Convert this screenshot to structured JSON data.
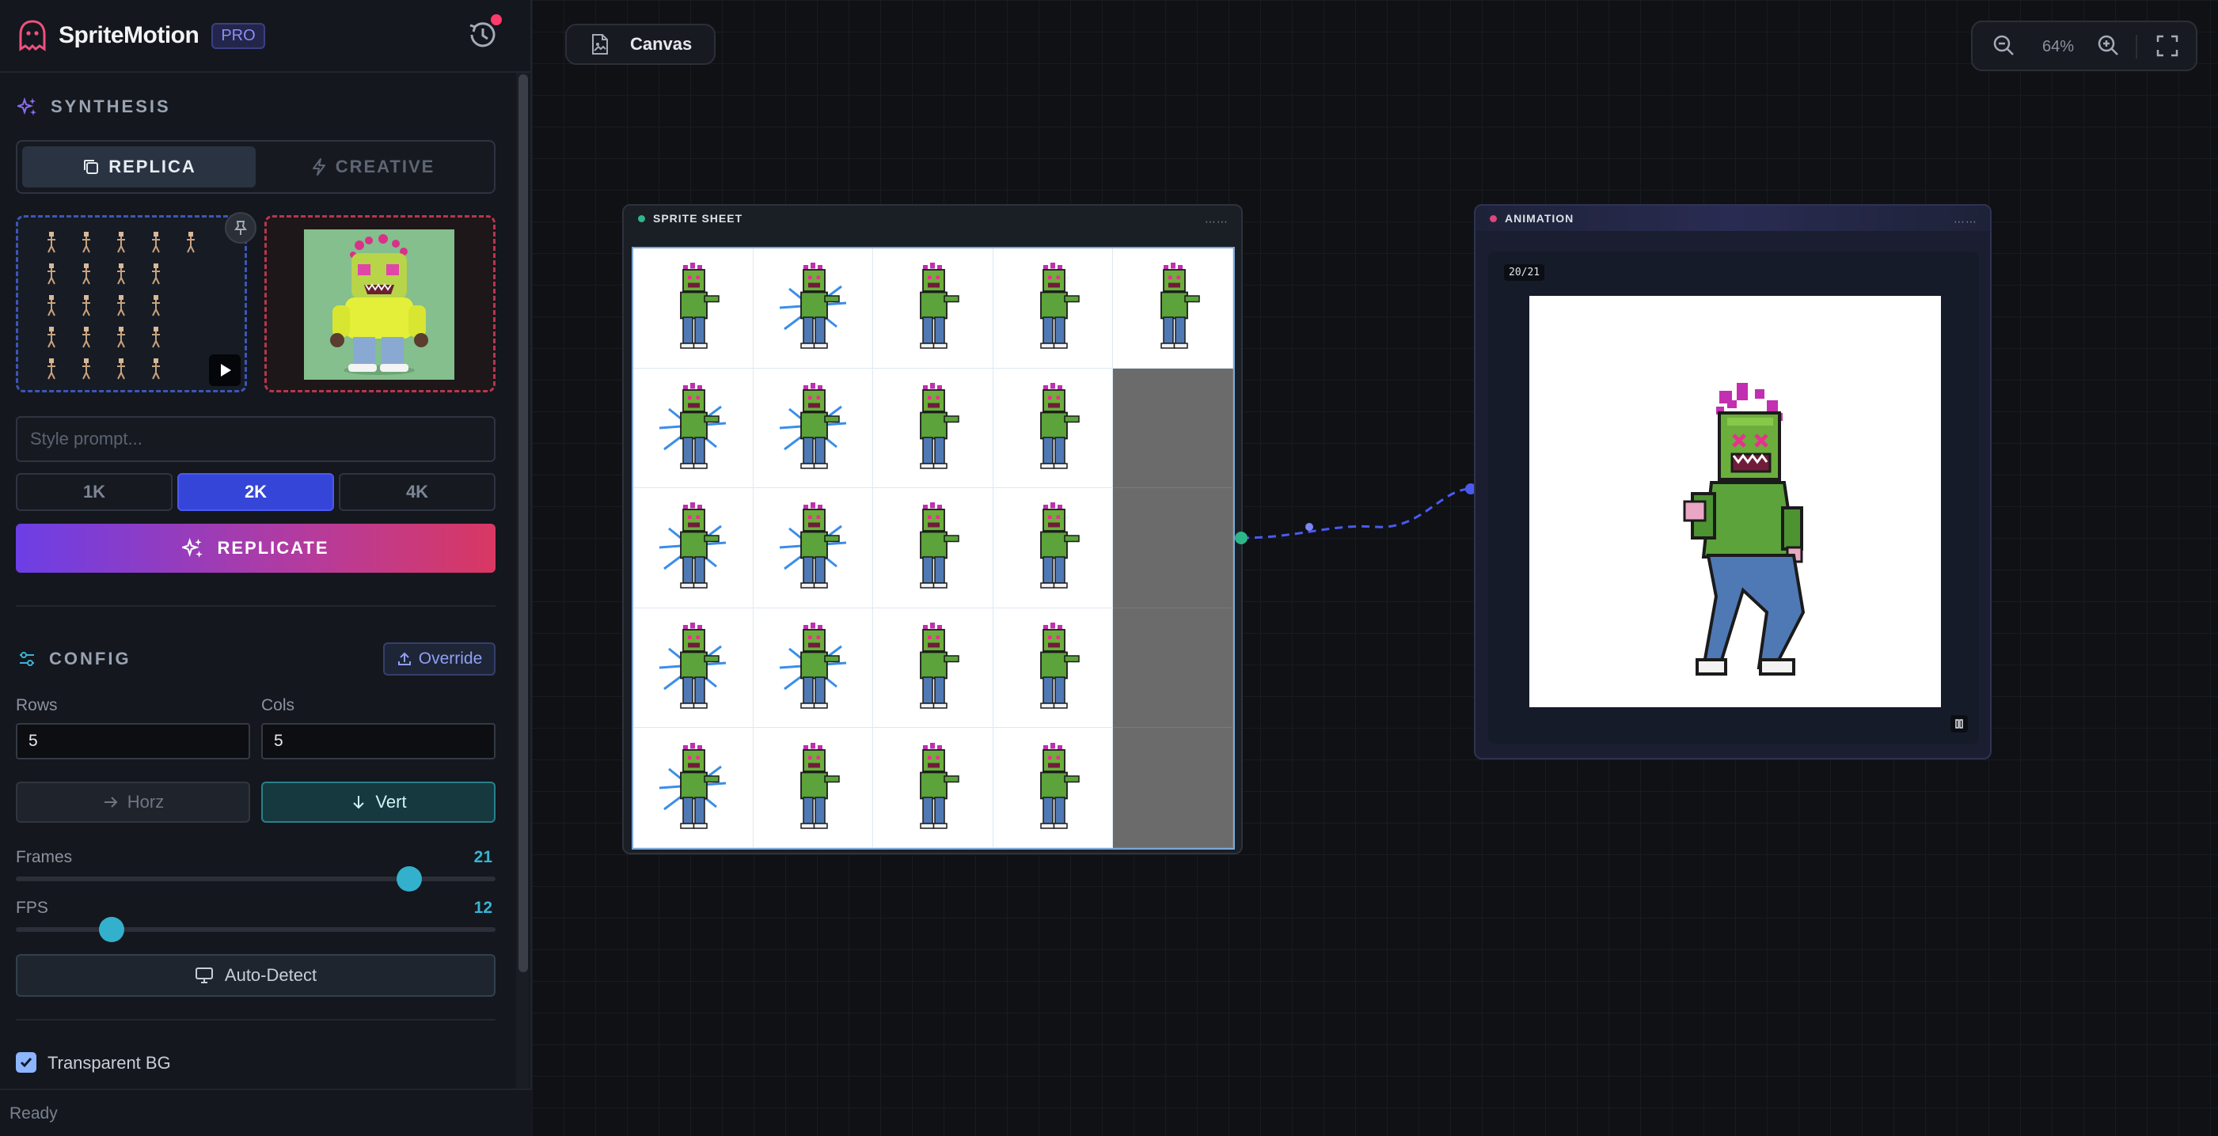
{
  "app": {
    "brand": "SpriteMotion",
    "badge": "PRO",
    "status": "Ready"
  },
  "synthesis": {
    "title": "SYNTHESIS",
    "modes": [
      "REPLICA",
      "CREATIVE"
    ],
    "active_mode": "REPLICA",
    "prompt_placeholder": "Style prompt...",
    "resolutions": [
      "1K",
      "2K",
      "4K"
    ],
    "active_resolution": "2K",
    "replicate_label": "REPLICATE"
  },
  "config": {
    "title": "CONFIG",
    "override_label": "Override",
    "rows_label": "Rows",
    "rows_value": "5",
    "cols_label": "Cols",
    "cols_value": "5",
    "horz_label": "Horz",
    "vert_label": "Vert",
    "active_direction": "Vert",
    "frames_label": "Frames",
    "frames_value": "21",
    "frames_fraction": 0.82,
    "fps_label": "FPS",
    "fps_value": "12",
    "fps_fraction": 0.2,
    "autodetect_label": "Auto-Detect",
    "transparent_label": "Transparent BG",
    "transparent_checked": true
  },
  "canvas": {
    "tab_label": "Canvas",
    "zoom_level": "64%"
  },
  "nodes": {
    "sprite_sheet": {
      "title": "SPRITE SHEET",
      "dot_color": "#2fb58a",
      "filled_cells": 21,
      "total_cells": 25
    },
    "animation": {
      "title": "ANIMATION",
      "dot_color": "#e0457b",
      "frame_counter": "20/21"
    }
  },
  "colors": {
    "accent": "#3545d8",
    "teal": "#33b0cc",
    "pink": "#e0457b"
  },
  "icons": {
    "logo": "ghost-icon",
    "history": "history-icon",
    "synthesis": "sparkles-icon",
    "config": "sliders-icon",
    "canvas": "file-image-icon"
  }
}
